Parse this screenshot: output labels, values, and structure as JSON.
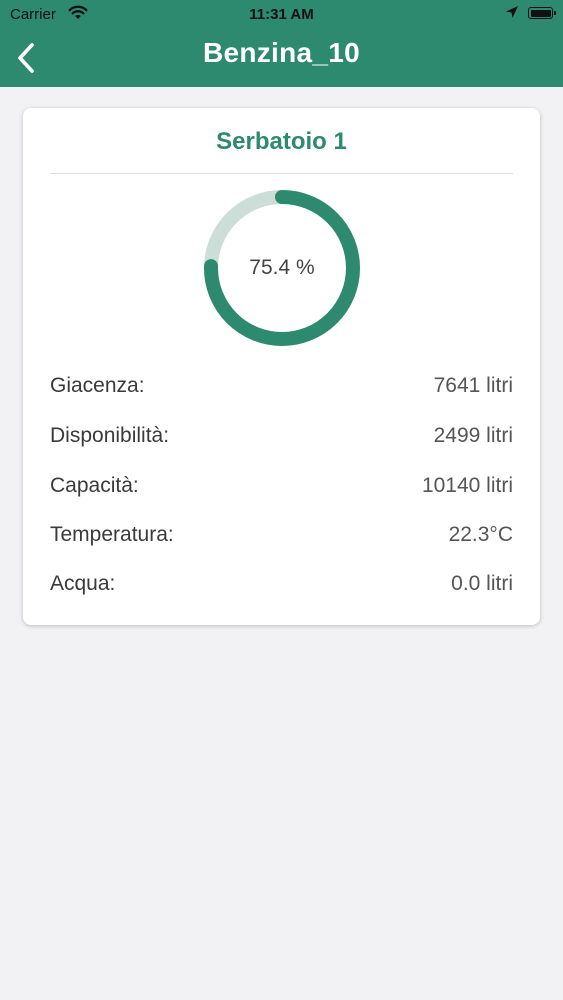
{
  "status_bar": {
    "carrier": "Carrier",
    "time": "11:31 AM"
  },
  "nav": {
    "title": "Benzina_10"
  },
  "tank": {
    "title": "Serbatoio 1",
    "fill_percent": 75.4,
    "fill_label": "75.4 %",
    "rows": [
      {
        "label": "Giacenza:",
        "value": "7641 litri"
      },
      {
        "label": "Disponibilità:",
        "value": "2499 litri"
      },
      {
        "label": "Capacità:",
        "value": "10140 litri"
      },
      {
        "label": "Temperatura:",
        "value": "22.3°C"
      },
      {
        "label": "Acqua:",
        "value": "0.0 litri"
      }
    ]
  },
  "colors": {
    "accent": "#2e8a6e",
    "ring_track": "#cdddd8",
    "background": "#f2f2f4"
  },
  "icons": {
    "back": "chevron-left-icon",
    "wifi": "wifi-icon",
    "location": "location-arrow-icon",
    "battery": "battery-icon"
  }
}
